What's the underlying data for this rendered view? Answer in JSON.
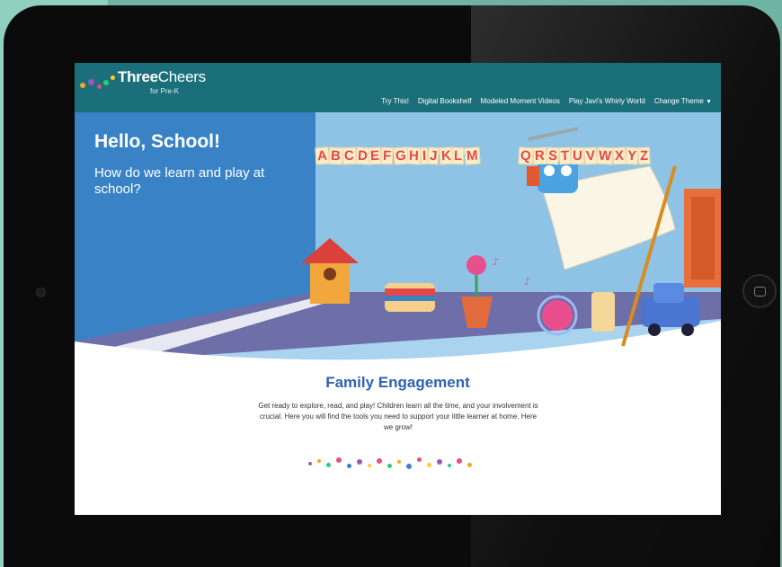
{
  "brand": {
    "name_bold": "Three",
    "name_light": "Cheers",
    "tagline": "for Pre-K"
  },
  "nav": {
    "items": [
      "Try This!",
      "Digital Bookshelf",
      "Modeled Moment Videos",
      "Play Javi's Whirly World"
    ],
    "theme_label": "Change Theme"
  },
  "hero": {
    "title": "Hello, School!",
    "subtitle": "How do we learn and play at school?",
    "banner_letters": [
      "A",
      "B",
      "C",
      "D",
      "E",
      "F",
      "G",
      "H",
      "I",
      "J",
      "K",
      "L",
      "M",
      "Q",
      "R",
      "S",
      "T",
      "U",
      "V",
      "W",
      "X",
      "Y",
      "Z"
    ]
  },
  "section": {
    "title": "Family Engagement",
    "body": "Get ready to explore, read, and play! Children learn all the time, and your involvement is crucial. Here you will find the tools you need to support your little learner at home. Here we grow!"
  },
  "colors": {
    "topbar": "#1b6f7a",
    "hero_blue": "#3a82c6",
    "title_blue": "#2f62b0",
    "accent_red": "#e24a4a"
  },
  "icons": {
    "menu_caret": "chevron-down-icon",
    "home_button": "home-button-icon"
  }
}
